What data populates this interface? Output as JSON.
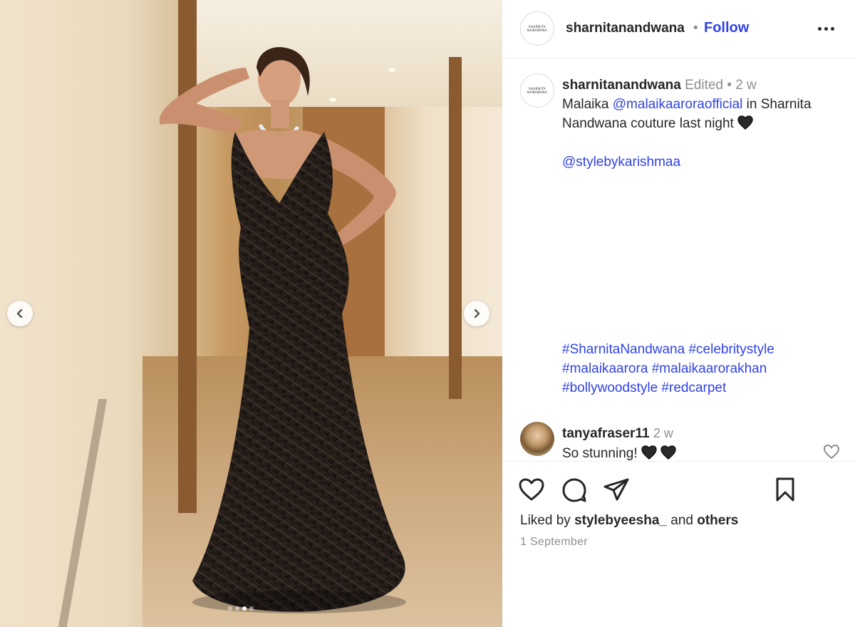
{
  "post": {
    "author": "sharnitanandwana",
    "author_logo_text": "SHARNITA NANDWANA",
    "follow_label": "Follow",
    "separator": "•"
  },
  "caption": {
    "username": "sharnitanandwana",
    "edited": "Edited",
    "dot": "•",
    "time": "2 w",
    "text_before": "Malaika",
    "mention1": "@malaikaaroraofficial",
    "text_after": "in Sharnita Nandwana couture last night",
    "mention2": "@stylebykarishmaa",
    "hashtags_line1": [
      "#SharnitaNandwana",
      "#celebritystyle"
    ],
    "hashtags_line2": [
      "#malaikaarora",
      "#malaikaarorakhan"
    ],
    "hashtags_line3": [
      "#bollywoodstyle",
      "#redcarpet"
    ]
  },
  "comment": {
    "username": "tanyafraser11",
    "time": "2 w",
    "text": "So stunning!"
  },
  "footer": {
    "liked_by_prefix": "Liked by",
    "liked_by_user": "stylebyeesha_",
    "and": "and",
    "others": "others",
    "date": "1 September"
  },
  "carousel": {
    "total": 4,
    "active_index": 2
  },
  "icons": {
    "prev": "chevron-left-icon",
    "next": "chevron-right-icon",
    "like": "heart-outline-icon",
    "comment": "speech-bubble-icon",
    "share": "paper-plane-icon",
    "save": "bookmark-icon",
    "more": "ellipsis-icon"
  },
  "colors": {
    "link": "#3143e6",
    "muted": "#8e8e8e",
    "text": "#262626"
  }
}
